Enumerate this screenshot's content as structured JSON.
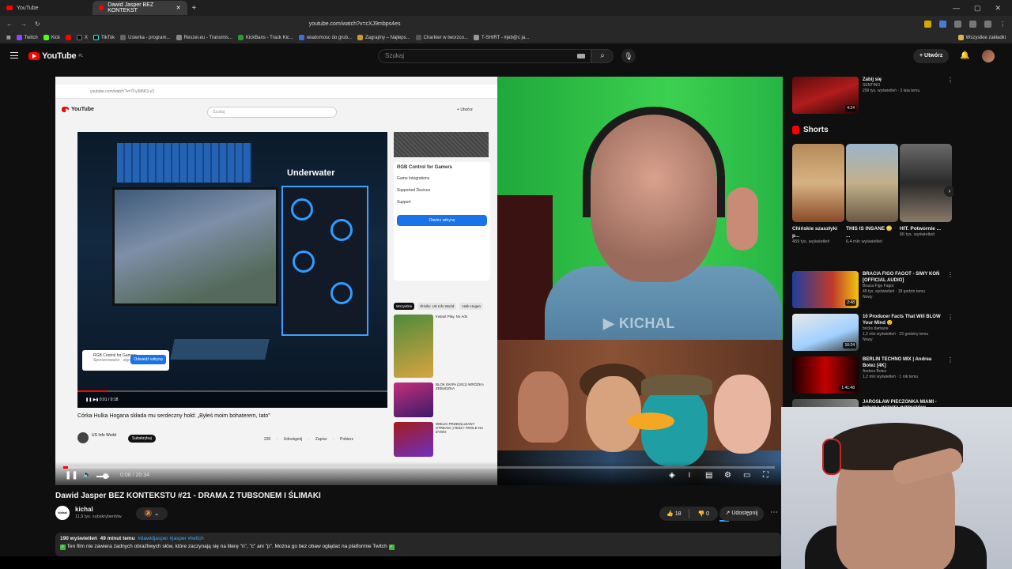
{
  "browser": {
    "tabs": [
      {
        "label": "YouTube"
      },
      {
        "label": "Dawid Jasper BEZ KONTEKST"
      }
    ],
    "url": "youtube.com/watch?v=cXJ9mbps4es",
    "bookmarks": [
      "Twitch",
      "Kick",
      "X",
      "TikTok",
      "Usterka - program...",
      "Reszei.eu - Transmis...",
      "KickBans - Track Kic...",
      "wiadomosc do grub...",
      "Zagrajmy – Najleps...",
      "Charkter w tworzco...",
      "T-SHIRT - #jeb@c ja..."
    ],
    "bookmarks_right": "Wszystkie zakładki"
  },
  "header": {
    "logo": "YouTube",
    "region": "PL",
    "search_placeholder": "Szukaj",
    "create_label": "Utwórz"
  },
  "player": {
    "time": "0:08 / 20:34",
    "progress": 0.0065,
    "watermark": "KICHAL",
    "inner": {
      "url": "youtube.com/watch?v=7Fy3b5K3-y3",
      "logo": "YouTube",
      "search_placeholder": "Szukaj",
      "create": "Utwórz",
      "video_text": "Underwater",
      "ad_name": "RGB Control for Gamers",
      "ad_sponsor": "Sponsorowane · signalrgb.com",
      "ad_visit": "Odwiedź witrynę",
      "time": "0:01 / 0:18",
      "title": "Córka Hulka Hogana składa mu serdeczny hołd: „Byłeś moim bohaterem, tato\"",
      "channel": "US Info World",
      "subscribe": "Subskrybuj",
      "actions": "230 · Udostępnij · Zapisz · Pobierz",
      "side_ad_title": "RGB Control for Gamers",
      "side_ad_rows": [
        "Game Integrations",
        "Supported Devices",
        "Support"
      ],
      "side_ad_cta": "Otwórz witrynę",
      "chips": [
        "Wszystkie",
        "Źródło: US Info World",
        "Hulk Hogan"
      ],
      "recs": [
        "Instant Play, No Ads",
        "BLOK EKIPA (1911) WRÓŻKA ZEBUDZKA",
        "WIELKI PRZEDLUZANY STREAM :) RIZZ I TROLE NA ŻYWO"
      ]
    }
  },
  "video": {
    "title": "Dawid Jasper BEZ KONTEKSTU #21 - DRAMA Z TUBSONEM I ŚLIMAKI",
    "channel": "kichal",
    "channel_avatar_text": "kichal",
    "subscribers": "11,9 tys. subskrybentów",
    "likes": "18",
    "dislikes": "0",
    "share": "Udostępnij",
    "views": "190 wyświetleń",
    "ago": "49 minut temu",
    "tags": "#dawidjasper #jasper #twitch",
    "description": "Ten film nie zawiera żadnych obraźliwych słów, które zaczynają się na literę \"n\", \"c\" ani \"p\". Można go bez obaw oglądać na platformie Twitch"
  },
  "sidebar": {
    "top_item": {
      "title": "Zabij się",
      "channel": "SENTINO",
      "meta": "299 tys. wyświetleń · 3 lata temu",
      "duration": "4:24"
    },
    "shorts_heading": "Shorts",
    "shorts": [
      {
        "title": "Chińskie szaszłyki p...",
        "views": "459 tys. wyświetleń"
      },
      {
        "title": "THIS IS INSANE 😳 ...",
        "views": "6,4 mln wyświetleń"
      },
      {
        "title": "HIT. Potwornie ...",
        "views": "66 tys. wyświetleń"
      }
    ],
    "items": [
      {
        "title": "BRACIA FIGO FAGOT - SIWY KOŃ [OFFICIAL AUDIO]",
        "channel": "Bracia Figo Fagot",
        "meta": "49 tys. wyświetleń · 18 godzin temu",
        "badge": "Nowy",
        "duration": "2:48"
      },
      {
        "title": "10 Producer Facts That Will BLOW Your Mind 😲",
        "channel": "bricks damane",
        "meta": "1,2 mln wyświetleń · 23 godziny temu",
        "badge": "Nowy",
        "duration": "16:24"
      },
      {
        "title": "BERLIN TECHNO MIX | Andrea Botez [4K]",
        "channel": "Andrea Botez",
        "meta": "1,2 mln wyświetleń · 1 rok temu",
        "badge": "",
        "duration": "1:41:48"
      },
      {
        "title": "JAROSŁAW PIECZONKA MIAMI - DRUGA WIZYTA INTRUZÓW",
        "channel": "",
        "meta": "",
        "badge": "",
        "duration": ""
      }
    ]
  }
}
